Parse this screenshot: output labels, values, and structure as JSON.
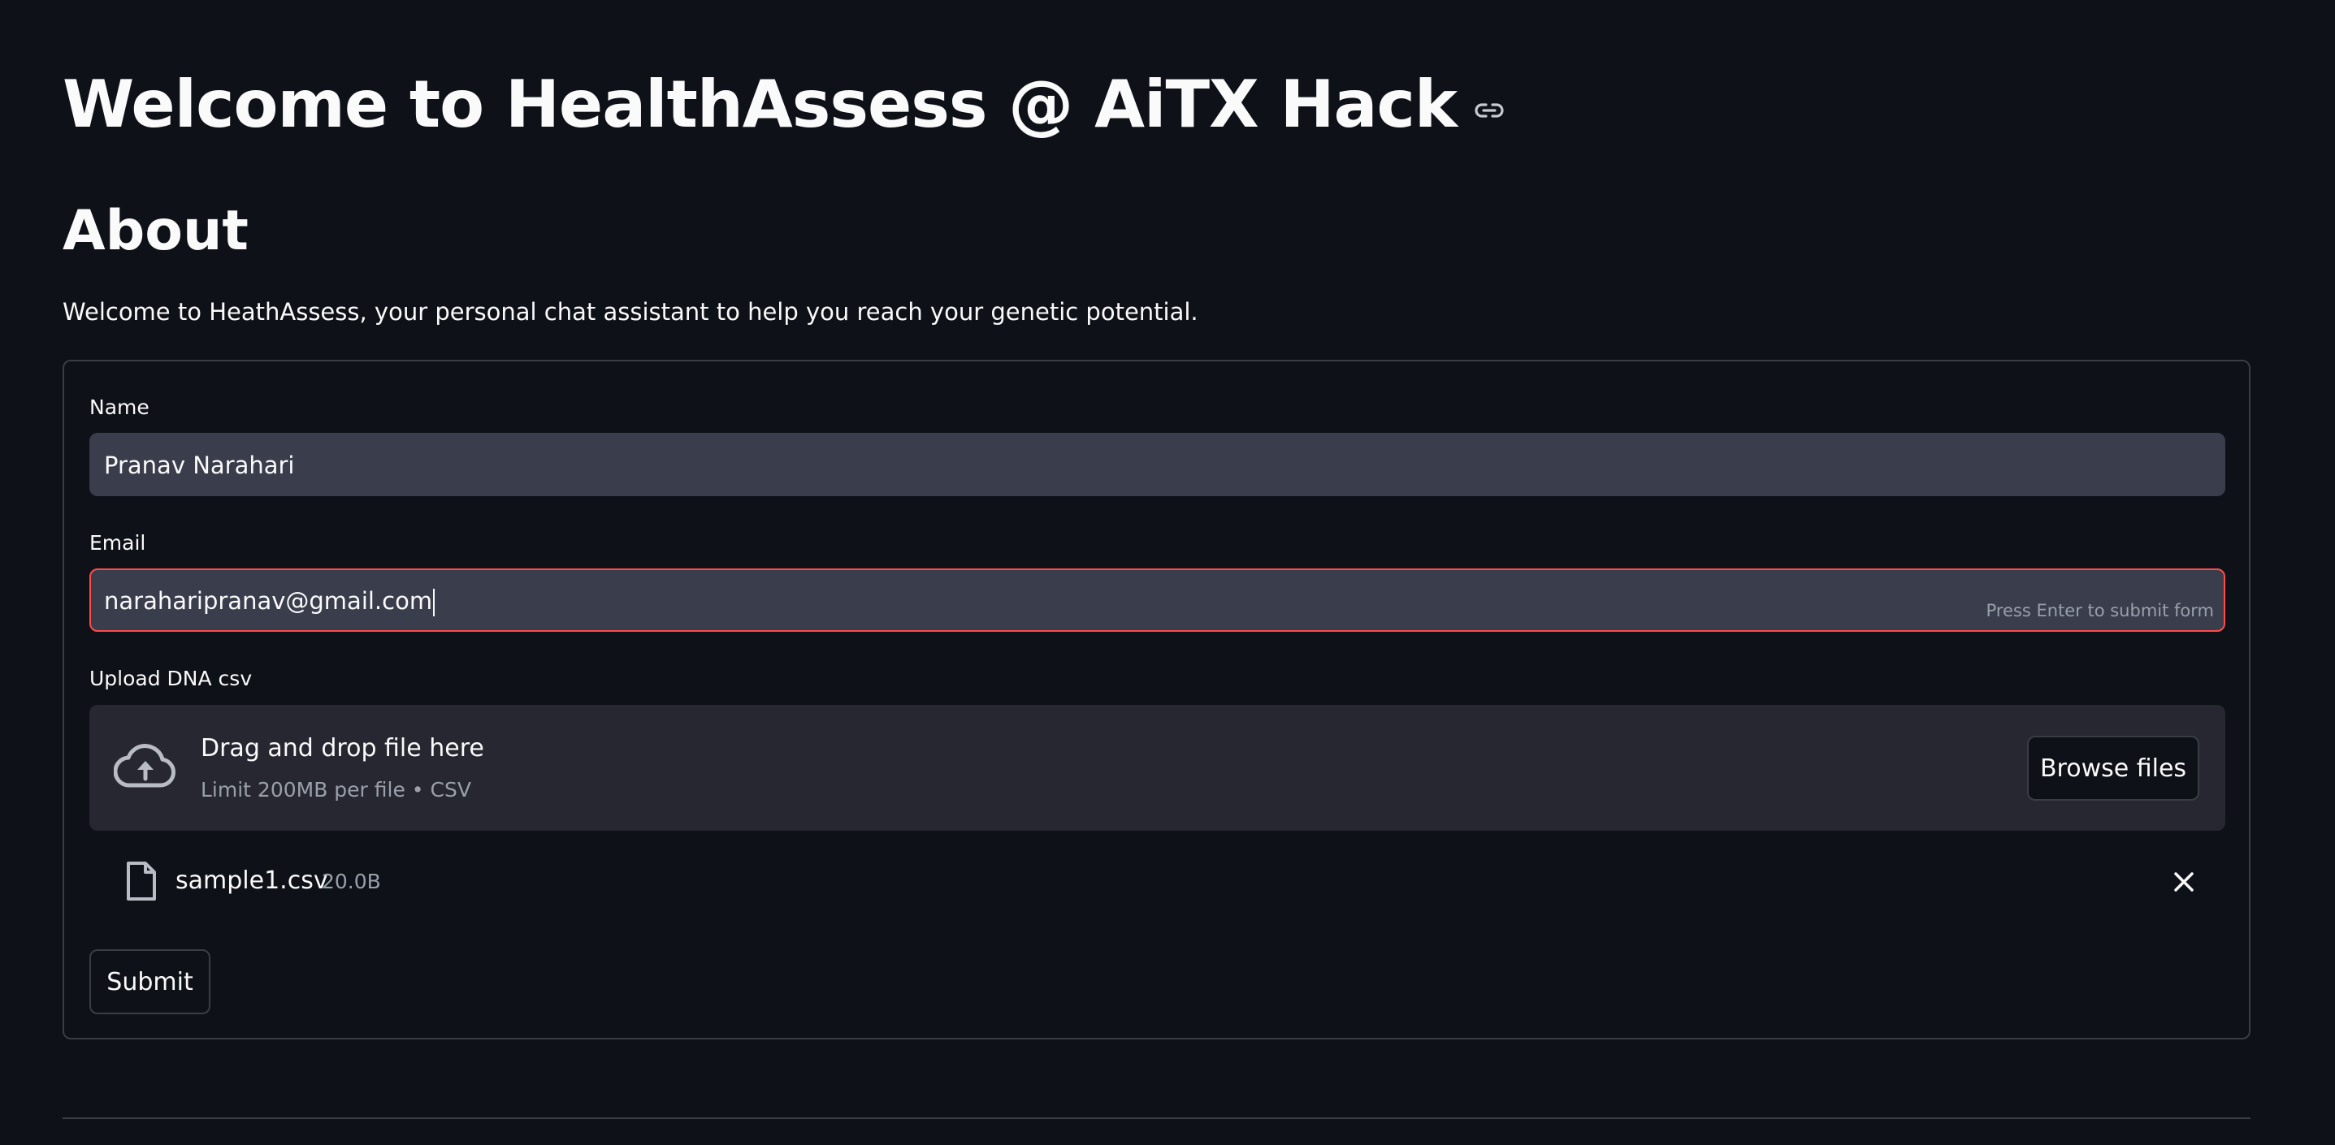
{
  "header": {
    "title": "Welcome to HealthAssess @ AiTX Hack",
    "anchor_icon": "link-icon"
  },
  "about": {
    "heading": "About",
    "description": "Welcome to HeathAssess, your personal chat assistant to help you reach your genetic potential."
  },
  "form": {
    "name": {
      "label": "Name",
      "value": "Pranav Narahari"
    },
    "email": {
      "label": "Email",
      "value": "naraharipranav@gmail.com",
      "hint": "Press Enter to submit form"
    },
    "upload": {
      "label": "Upload DNA csv",
      "dropzone_title": "Drag and drop file here",
      "dropzone_subtitle": "Limit 200MB per file • CSV",
      "browse_label": "Browse files",
      "icon": "cloud-upload-icon"
    },
    "uploaded_file": {
      "name": "sample1.csv",
      "size": "20.0B",
      "icon": "file-icon",
      "remove_icon": "close-icon"
    },
    "submit_label": "Submit"
  },
  "colors": {
    "background": "#0e1117",
    "input_background": "#393d4c",
    "dropzone_background": "#262730",
    "border": "#3a3d46",
    "focus_accent": "#ff4b4b",
    "muted_text": "#9aa0ab",
    "text": "#fafafa"
  }
}
